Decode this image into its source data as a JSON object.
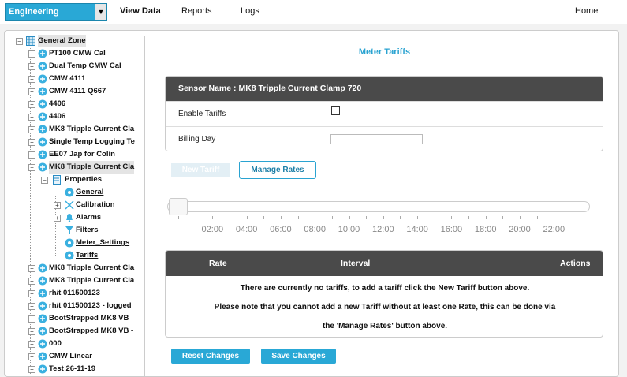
{
  "topbar": {
    "department": "Engineering",
    "nav": [
      "View Data",
      "Reports",
      "Logs"
    ],
    "home": "Home"
  },
  "tree": {
    "root": "General Zone",
    "sensors_top": [
      "PT100 CMW Cal",
      "Dual Temp CMW Cal",
      "CMW 4111",
      "CMW 4111 Q667",
      "4406",
      "4406",
      "MK8 Tripple Current Cla",
      "Single Temp Logging Te",
      "EE07 Jap for Colin"
    ],
    "selected_sensor": "MK8 Tripple Current Cla",
    "properties": "Properties",
    "children": [
      "General",
      "Calibration",
      "Alarms",
      "Filters",
      "Meter_Settings",
      "Tariffs"
    ],
    "sensors_bottom": [
      "MK8 Tripple Current Cla",
      "MK8 Tripple Current Cla",
      "rh/t 011500123",
      "rh/t 011500123 - logged",
      "BootStrapped MK8 VB",
      "BootStrapped MK8 VB -",
      "000",
      "CMW Linear",
      "Test 26-11-19"
    ]
  },
  "main": {
    "title": "Meter Tariffs",
    "sensor_name": "Sensor Name : MK8 Tripple Current Clamp 720",
    "enable_tariffs_label": "Enable Tariffs",
    "billing_day_label": "Billing Day",
    "new_tariff": "New Tariff",
    "manage_rates": "Manage Rates",
    "time_ticks": [
      "02:00",
      "04:00",
      "06:00",
      "08:00",
      "10:00",
      "12:00",
      "14:00",
      "16:00",
      "18:00",
      "20:00",
      "22:00"
    ],
    "table_headers": [
      "Rate",
      "Interval",
      "Actions"
    ],
    "messages": [
      "There are currently no tariffs, to add a tariff click the New Tariff button above.",
      "Please note that you cannot add a new Tariff without at least one Rate, this can be done via",
      "the 'Manage Rates' button above."
    ],
    "reset": "Reset Changes",
    "save": "Save Changes"
  },
  "colors": {
    "accent": "#29a8d6",
    "header": "#4a4a4a"
  }
}
